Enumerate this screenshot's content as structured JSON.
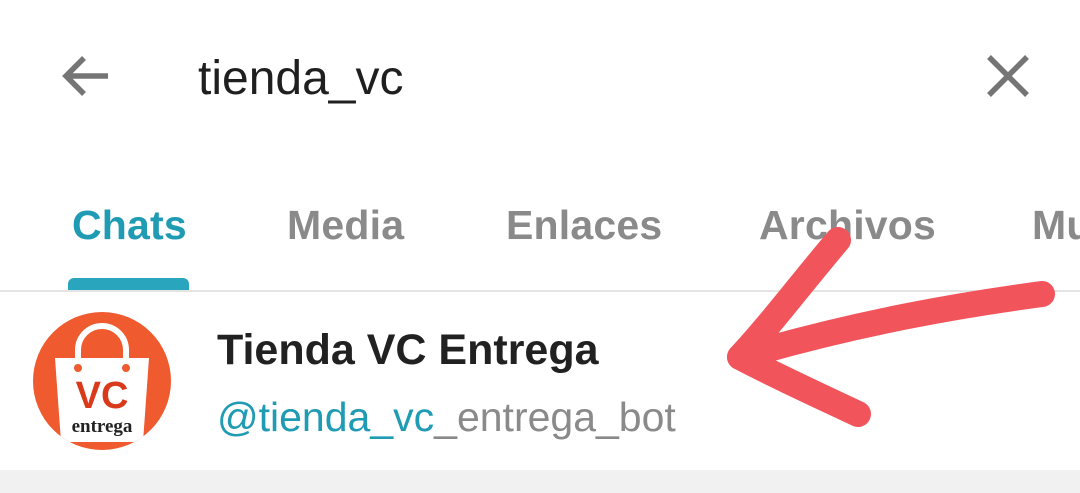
{
  "search": {
    "query": "tienda_vc"
  },
  "tabs": [
    {
      "label": "Chats",
      "active": true
    },
    {
      "label": "Media",
      "active": false
    },
    {
      "label": "Enlaces",
      "active": false
    },
    {
      "label": "Archivos",
      "active": false
    },
    {
      "label": "Mu",
      "active": false
    }
  ],
  "result": {
    "title": "Tienda VC Entrega",
    "username_match": "@tienda_vc",
    "username_rest": "_entrega_bot",
    "avatar": {
      "logo_text": "VC",
      "logo_subtext": "entrega"
    }
  },
  "colors": {
    "accent": "#1f9bb4",
    "tab_inactive": "#8a8a8a",
    "avatar_bg": "#ef5a2f",
    "annotation_arrow": "#f2545b"
  },
  "icons": {
    "back": "arrow-left",
    "clear": "close-x"
  }
}
